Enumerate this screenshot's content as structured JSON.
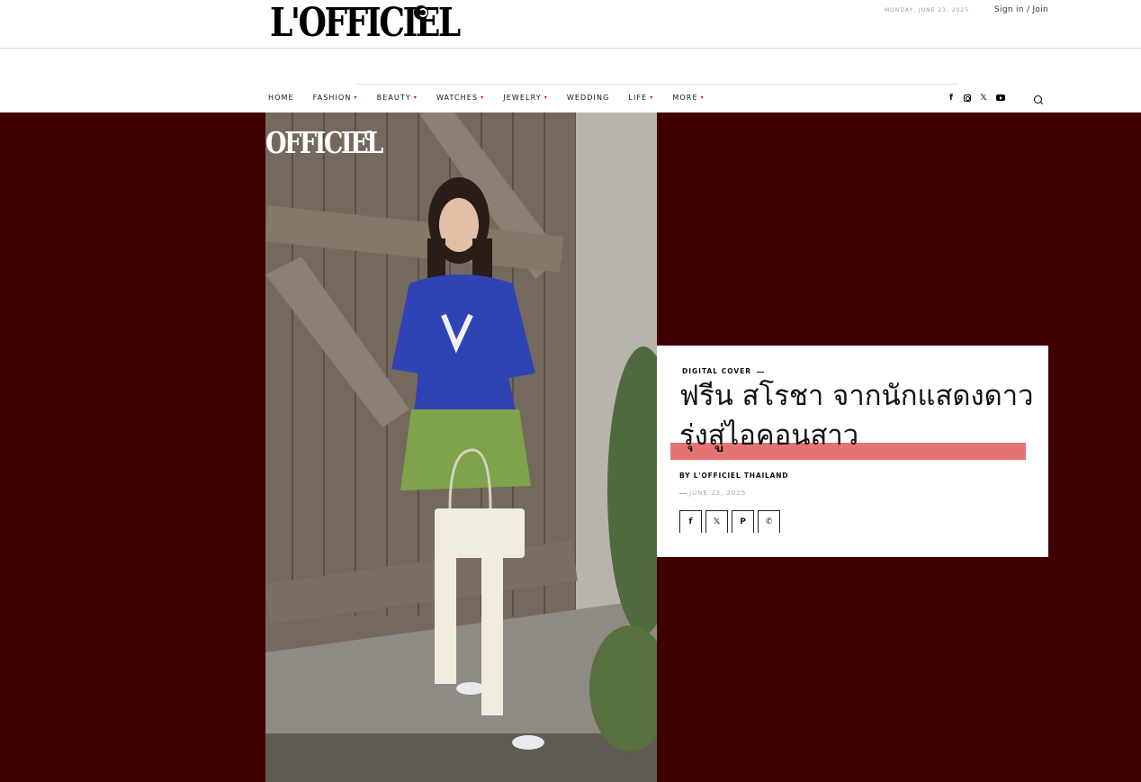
{
  "header": {
    "logo_text": "L'OFFICIEL",
    "date": "MONDAY, JUNE 23, 2025",
    "signin_label": "Sign in / Join"
  },
  "nav": {
    "items": [
      {
        "label": "HOME",
        "dropdown": false
      },
      {
        "label": "FASHION",
        "dropdown": true
      },
      {
        "label": "BEAUTY",
        "dropdown": true
      },
      {
        "label": "WATCHES",
        "dropdown": true
      },
      {
        "label": "JEWELRY",
        "dropdown": true
      },
      {
        "label": "WEDDING",
        "dropdown": false
      },
      {
        "label": "LIFE",
        "dropdown": true
      },
      {
        "label": "MORE",
        "dropdown": true
      }
    ],
    "caret": "▾",
    "social_icons": [
      "facebook-icon",
      "instagram-icon",
      "x-icon",
      "youtube-icon"
    ],
    "search_icon": "search-icon"
  },
  "hero": {
    "background_color": "#3f0000",
    "photo_logo_text": "OFFICIEL",
    "category": "DIGITAL COVER",
    "title": "ฟรีน สโรชา จากนักแสดงดาวรุ่งสู่ไอคอนสาว",
    "highlight_color": "#e67373",
    "author": "BY L'OFFICIEL THAILAND",
    "date": "JUNE 23, 2025",
    "share_buttons": [
      {
        "icon": "facebook-icon",
        "glyph": "f"
      },
      {
        "icon": "x-icon",
        "glyph": "𝕏"
      },
      {
        "icon": "pinterest-icon",
        "glyph": "P"
      },
      {
        "icon": "whatsapp-icon",
        "glyph": "✆"
      }
    ]
  }
}
